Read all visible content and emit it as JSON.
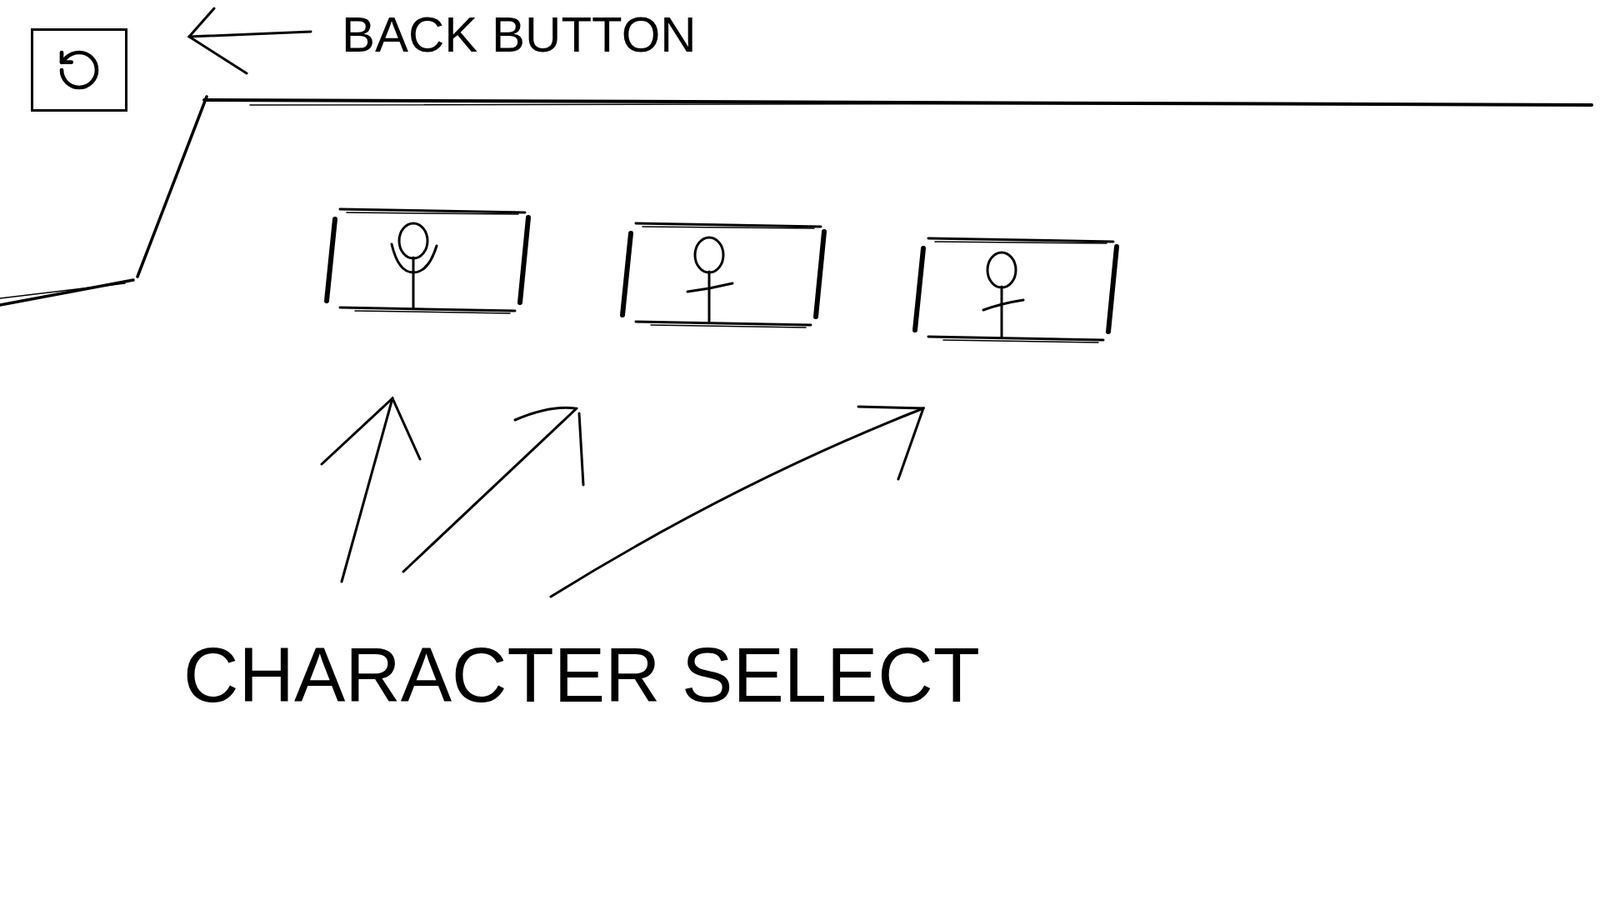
{
  "annotations": {
    "back_button": "BACK BUTTON",
    "character_select": "CHARACTER SELECT"
  },
  "characters": [
    {
      "kind": "cheer"
    },
    {
      "kind": "wave"
    },
    {
      "kind": "shrug"
    }
  ]
}
